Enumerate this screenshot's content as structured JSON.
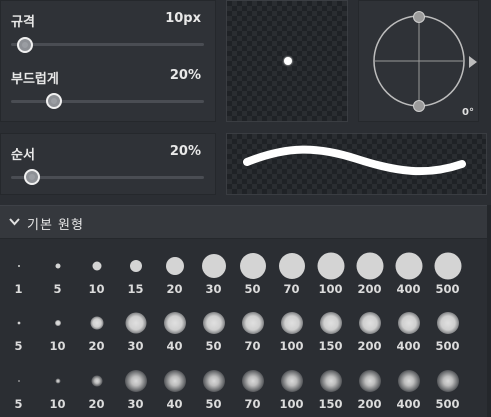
{
  "sliders": [
    {
      "label": "규격",
      "value": "10px",
      "fraction": 0.08
    },
    {
      "label": "부드럽게",
      "value": "20%",
      "fraction": 0.2
    },
    {
      "label": "순서",
      "value": "20%",
      "fraction": 0.11
    }
  ],
  "angle": {
    "value": "0°"
  },
  "section": {
    "title": "기본 원형"
  },
  "brush_rows": [
    {
      "style": "hard",
      "labels": [
        "1",
        "5",
        "10",
        "15",
        "20",
        "30",
        "50",
        "70",
        "100",
        "200",
        "400",
        "500"
      ]
    },
    {
      "style": "soft",
      "labels": [
        "5",
        "10",
        "20",
        "30",
        "40",
        "50",
        "70",
        "100",
        "150",
        "200",
        "400",
        "500"
      ]
    },
    {
      "style": "softer",
      "labels": [
        "5",
        "10",
        "20",
        "30",
        "40",
        "50",
        "70",
        "100",
        "150",
        "200",
        "400",
        "500"
      ]
    }
  ],
  "colors": {
    "panel": "#2f3237",
    "background": "#2b2e33",
    "brush": "#d9d9d9"
  }
}
